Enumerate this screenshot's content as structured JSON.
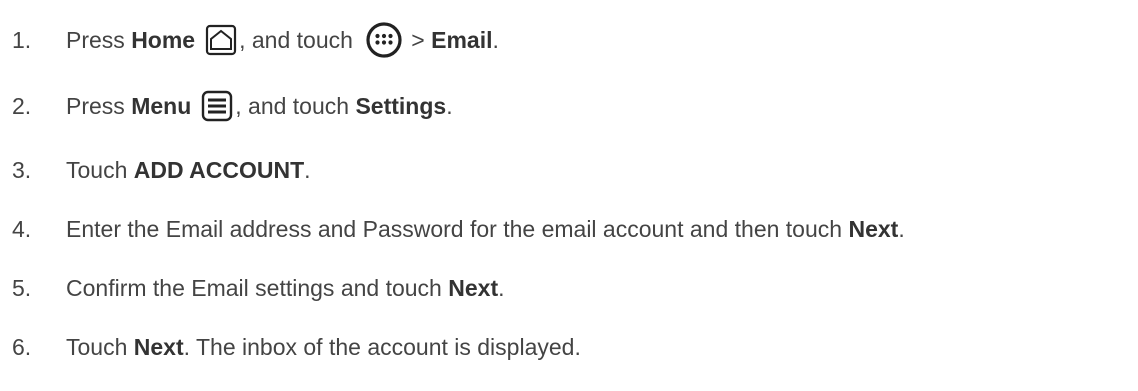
{
  "steps": [
    {
      "number": "1.",
      "prefix": "Press ",
      "bold1": "Home",
      "icon1": "home-icon",
      "mid": ", and touch",
      "icon2": "apps-icon",
      "sep": " > ",
      "bold2": "Email",
      "suffix": "."
    },
    {
      "number": "2.",
      "prefix": "Press ",
      "bold1": "Menu",
      "icon1": "menu-icon",
      "mid": ", and touch ",
      "bold2": "Settings",
      "suffix": "."
    },
    {
      "number": "3.",
      "prefix": "Touch ",
      "bold1": "ADD ACCOUNT",
      "suffix": "."
    },
    {
      "number": "4.",
      "prefix": "Enter the Email address and Password for the email account and then touch ",
      "bold1": "Next",
      "suffix": "."
    },
    {
      "number": "5.",
      "prefix": "Confirm the Email settings and touch ",
      "bold1": "Next",
      "suffix": "."
    },
    {
      "number": "6.",
      "prefix": "Touch ",
      "bold1": "Next",
      "suffix": ". The inbox of the account is displayed."
    }
  ]
}
